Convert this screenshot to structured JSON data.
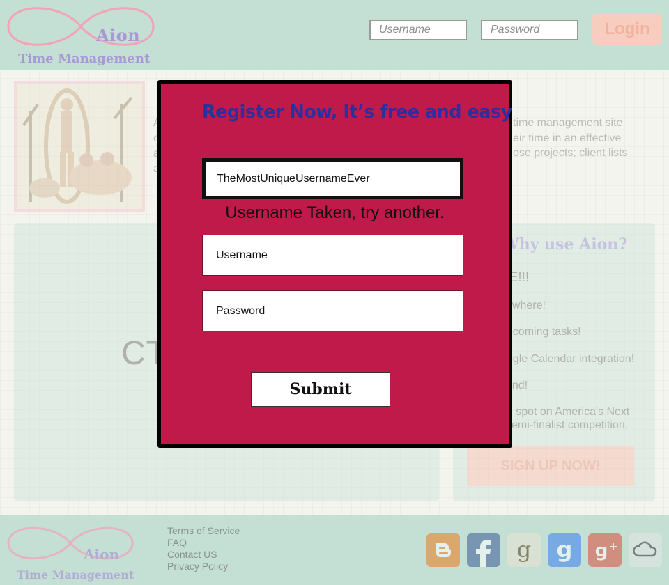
{
  "brand": {
    "name": "Aion",
    "tagline": "Time Management",
    "colors": {
      "infinity": "#f2a3b8",
      "text": "#a898d4",
      "header_bg": "#c4dfd4",
      "modal_bg": "#c01a4a"
    }
  },
  "header": {
    "username_placeholder": "Username",
    "password_placeholder": "Password",
    "login_label": "Login"
  },
  "intro": {
    "left_letters": [
      "A",
      "o",
      "a",
      "a"
    ],
    "right_lines": [
      "time management site",
      "eir time in an effective",
      "ose projects; client lists"
    ]
  },
  "left_panel": {
    "text": "CT"
  },
  "why": {
    "title": "Why use Aion?",
    "items": [
      "EE!!!",
      "nywhere!",
      "upcoming tasks!",
      "oogle Calendar integration!",
      "mind!",
      "ed spot on America's Next",
      "l semi-finalist competition."
    ],
    "signup_label": "SIGN UP NOW!"
  },
  "modal": {
    "title": "Register Now, It’s free and easy",
    "taken_username_value": "TheMostUniqueUsernameEver",
    "error_message": "Username Taken, try another.",
    "username_placeholder": "Username",
    "password_placeholder": "Password",
    "submit_label": "Submit"
  },
  "footer": {
    "links": [
      "Terms of Service",
      "FAQ",
      "Contact US",
      "Privacy Policy"
    ],
    "social_icons": [
      "blogger-icon",
      "facebook-icon",
      "goodreads-icon",
      "google-icon",
      "google-plus-icon",
      "cloud-icon"
    ]
  }
}
